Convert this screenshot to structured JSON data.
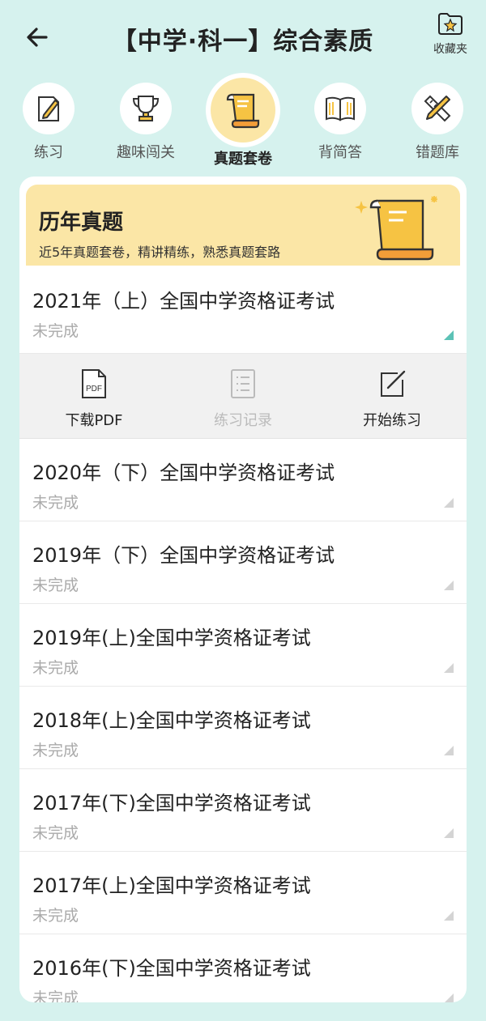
{
  "header": {
    "title": "【中学·科一】综合素质",
    "favorites_label": "收藏夹"
  },
  "tabs": [
    {
      "label": "练习",
      "icon": "pencil-paper-icon"
    },
    {
      "label": "趣味闯关",
      "icon": "trophy-icon"
    },
    {
      "label": "真题套卷",
      "icon": "scroll-icon",
      "active": true
    },
    {
      "label": "背简答",
      "icon": "book-icon"
    },
    {
      "label": "错题库",
      "icon": "pencil-ruler-icon"
    }
  ],
  "banner": {
    "title": "历年真题",
    "subtitle": "近5年真题套卷，精讲精练，熟悉真题套路"
  },
  "exams": [
    {
      "title": "2021年（上）全国中学资格证考试",
      "status": "未完成"
    },
    {
      "title": "2020年（下）全国中学资格证考试",
      "status": "未完成"
    },
    {
      "title": "2019年（下）全国中学资格证考试",
      "status": "未完成"
    },
    {
      "title": "2019年(上)全国中学资格证考试",
      "status": "未完成"
    },
    {
      "title": "2018年(上)全国中学资格证考试",
      "status": "未完成"
    },
    {
      "title": "2017年(下)全国中学资格证考试",
      "status": "未完成"
    },
    {
      "title": "2017年(上)全国中学资格证考试",
      "status": "未完成"
    },
    {
      "title": "2016年(下)全国中学资格证考试",
      "status": "未完成"
    }
  ],
  "actions": {
    "download_pdf": "下载PDF",
    "records": "练习记录",
    "start": "开始练习",
    "pdf_badge": "PDF"
  },
  "colors": {
    "background": "#d6f2ee",
    "accent_yellow": "#fbe6a6",
    "accent_teal": "#5cc2b6"
  }
}
